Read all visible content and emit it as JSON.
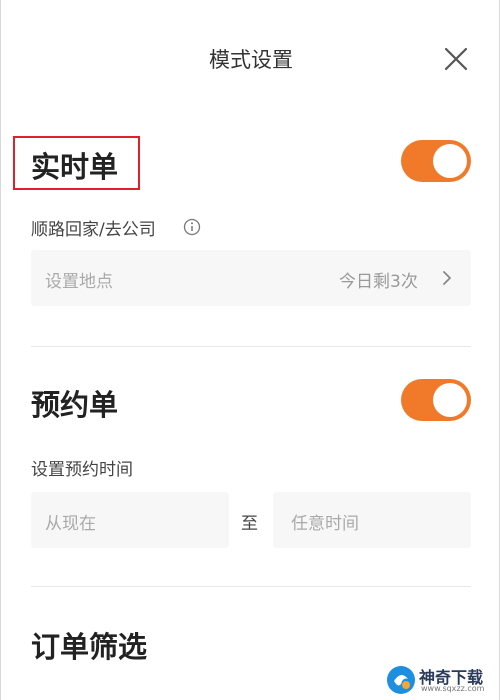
{
  "header": {
    "title": "模式设置",
    "close_icon": "close-icon"
  },
  "realtime": {
    "title": "实时单",
    "toggle_on": true,
    "sub_label": "顺路回家/去公司",
    "info_icon": "info-icon",
    "location_placeholder": "设置地点",
    "remaining_text": "今日剩3次",
    "chevron_icon": "chevron-right-icon"
  },
  "reservation": {
    "title": "预约单",
    "toggle_on": true,
    "sub_label": "设置预约时间",
    "from_placeholder": "从现在",
    "to_label": "至",
    "to_placeholder": "任意时间"
  },
  "filter": {
    "title": "订单筛选"
  },
  "watermark": {
    "name": "神奇下载",
    "url": "www.sqxzz.com"
  },
  "colors": {
    "accent": "#f07a2a",
    "highlight_border": "#e0202a",
    "field_bg": "#f7f7f7"
  }
}
